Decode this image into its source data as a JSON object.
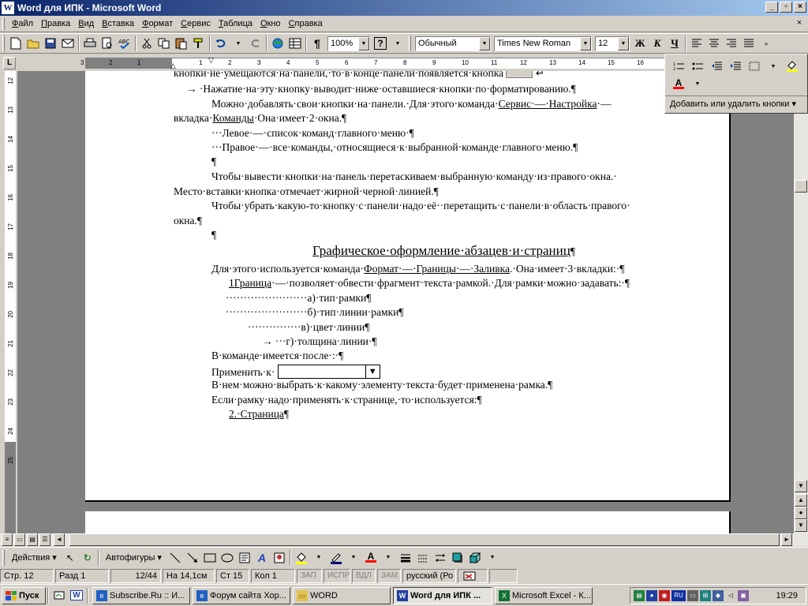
{
  "window": {
    "title": "Word для  ИПК - Microsoft Word",
    "app_icon": "W",
    "controls": {
      "minimize": "_",
      "restore": "▫",
      "close": "×"
    }
  },
  "menubar": {
    "items": [
      "Файл",
      "Правка",
      "Вид",
      "Вставка",
      "Формат",
      "Сервис",
      "Таблица",
      "Окно",
      "Справка"
    ],
    "close_doc": "×"
  },
  "toolbar": {
    "zoom": "100%",
    "style": "Обычный",
    "font": "Times New Roman",
    "size": "12",
    "bold": "Ж",
    "italic": "К",
    "underline": "Ч",
    "pilcrow": "¶",
    "help": "?"
  },
  "popup": {
    "add_remove": "Добавить или удалить кнопки ▾",
    "font_color_glyph": "A"
  },
  "ruler": {
    "corner": "L",
    "h_numbers": [
      "3",
      "2",
      "1",
      "1",
      "2",
      "3",
      "4",
      "5",
      "6",
      "7",
      "8",
      "9",
      "10",
      "11",
      "12",
      "13",
      "14",
      "15",
      "16"
    ],
    "v_numbers": [
      "12",
      "13",
      "14",
      "15",
      "16",
      "17",
      "18",
      "19",
      "20",
      "21",
      "22",
      "23",
      "24",
      "25"
    ]
  },
  "document": {
    "lines": [
      "кнопки·не·умещаются·на·панели,·то·в·конце·панели·появляется·кнопка",
      "→   ·Нажатие·на·эту·кнопку·выводит·ниже·оставшиеся·кнопки·по·форматированию.¶",
      "Можно·добавлять·свои·кнопки·на·панели.·Для·этого·команда·",
      "вкладка·",
      "···Левое·—·список·команд·главного·меню·¶",
      "···Правое·—·все·команды,·относящиеся·к·выбранной·команде·главного·меню.¶",
      "¶",
      "Чтобы·вывести·кнопки·на·панель·перетаскиваем·выбранную·команду·из·правого·окна.·",
      "Место·вставки·кнопка·отмечает·жирной·черной·линией.¶",
      "Чтобы·убрать·какую-то·кнопку·с·панели·надо·её··перетащить·с·панели·в·область·правого·",
      "окна.¶",
      "¶",
      "Графическое·оформление·абзацев·и·страниц",
      "Для·этого·используется·команда·",
      "1Граница",
      "·······················а)·тип·рамки¶",
      "·······················б)·тип·линии·рамки¶",
      "···············в)·цвет·линии¶",
      "→    ···г)·толщина·линии·¶",
      "В·команде·имеется·после·:·¶",
      "Применить·к·",
      "В·нем·можно·выбрать·к·какому·элементу·текста·будет·применена·рамка.¶",
      "Если·рамку·надо·применять·к·странице,·то·используется:¶",
      "2.·Страница",
      "¶"
    ],
    "line2_link": "Сервис·—·Настройка",
    "line2_tail": "·—",
    "line3_link": "Команды",
    "line3_tail": "·Она·имеет·2·окна.¶",
    "format_link": "Формат·—·Границы·—·Заливка",
    "format_tail": ".·Она·имеет·3·вкладки:·¶",
    "border_tail": "·—·позволяет·обвести·фрагмент·текста·рамкой.·Для·рамки·можно·задавать:·¶",
    "return_mark": "↵",
    "combo_arrow": "▼"
  },
  "drawbar": {
    "actions": "Действия ▾",
    "autoshapes": "Автофигуры ▾"
  },
  "status": {
    "page": "Стр. 12",
    "section": "Разд 1",
    "pages": "12/44",
    "position": "На 14,1см",
    "line": "Ст 15",
    "column": "Кол 1",
    "rec": "ЗАП",
    "trk": "ИСПР",
    "ext": "ВДЛ",
    "ovr": "ЗАМ",
    "language": "русский (Ро"
  },
  "taskbar": {
    "start": "Пуск",
    "tasks": [
      "Subscribe.Ru :: И...",
      "Форум сайта Хор...",
      "WORD",
      "Word для  ИПК ...",
      "Microsoft Excel - К..."
    ],
    "lang": "RU",
    "clock": "19:29"
  },
  "colors": {
    "title_active": "#0a246a",
    "face": "#d4d0c8",
    "workspace": "#808080"
  }
}
